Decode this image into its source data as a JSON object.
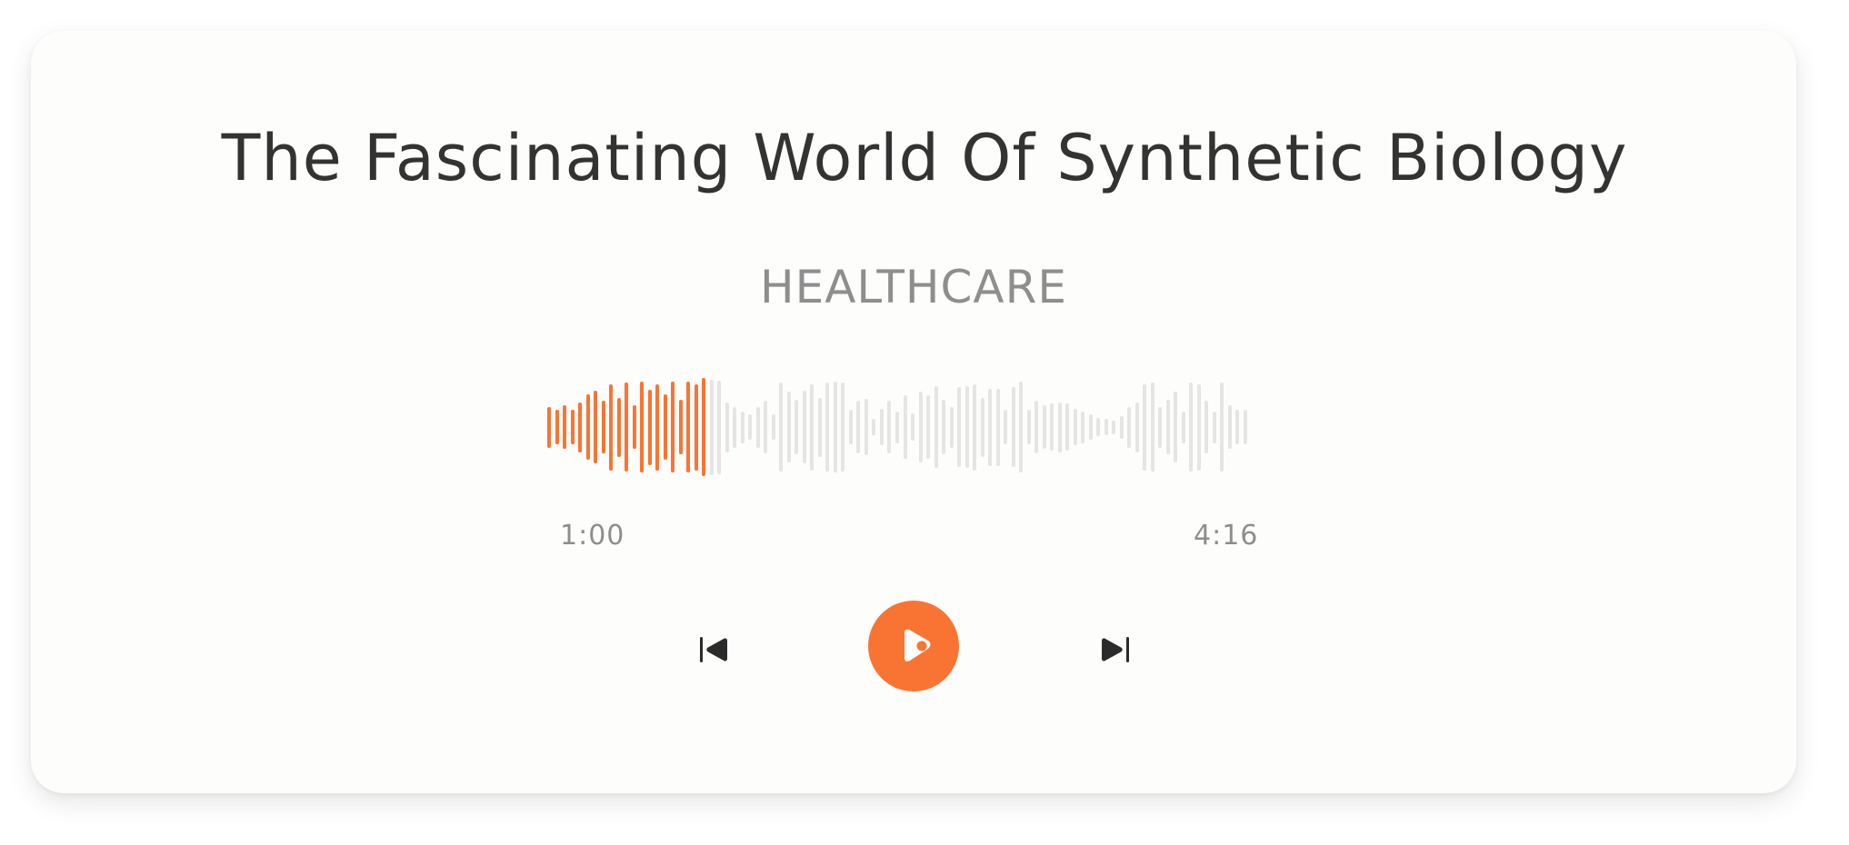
{
  "track": {
    "title": "The Fascinating World Of Synthetic Biology",
    "category": "HEALTHCARE"
  },
  "player": {
    "current_time": "1:00",
    "total_time": "4:16",
    "progress": 0.234,
    "controls": {
      "previous_icon": "skip-previous-icon",
      "play_icon": "play-icon",
      "next_icon": "skip-next-icon"
    }
  },
  "colors": {
    "accent": "#f97433",
    "played_bar": "#f97433",
    "unplayed_bar": "#e5e5e3",
    "title_text": "#333333",
    "muted_text": "#8e8e8e",
    "card_background": "#fdfdfb"
  },
  "waveform": {
    "levels": [
      0.45,
      0.38,
      0.48,
      0.38,
      0.55,
      0.72,
      0.8,
      0.58,
      0.95,
      0.65,
      0.98,
      0.48,
      1.0,
      0.83,
      0.95,
      0.72,
      1.0,
      0.6,
      1.0,
      0.95,
      1.08,
      1.05,
      1.03,
      0.55,
      0.45,
      0.35,
      0.28,
      0.45,
      0.58,
      0.28,
      0.98,
      0.78,
      0.6,
      0.8,
      0.95,
      0.65,
      0.98,
      1.0,
      0.98,
      0.38,
      0.58,
      0.62,
      0.18,
      0.4,
      0.58,
      0.35,
      0.7,
      0.3,
      0.78,
      0.7,
      0.9,
      0.6,
      0.45,
      0.88,
      0.9,
      0.95,
      0.65,
      0.85,
      0.85,
      0.38,
      0.88,
      1.0,
      0.38,
      0.58,
      0.48,
      0.52,
      0.55,
      0.52,
      0.4,
      0.35,
      0.28,
      0.2,
      0.18,
      0.15,
      0.25,
      0.45,
      0.55,
      0.95,
      0.98,
      0.45,
      0.6,
      0.78,
      0.35,
      0.98,
      0.95,
      0.58,
      0.35,
      0.98,
      0.48,
      0.38,
      0.38
    ]
  }
}
